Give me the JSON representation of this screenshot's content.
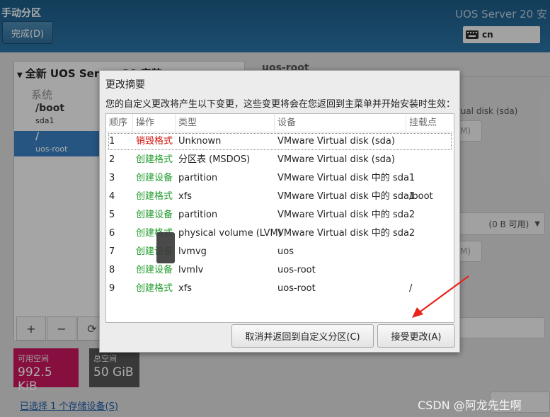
{
  "header": {
    "title": "手动分区",
    "done_label": "完成(D)",
    "product": "UOS Server 20 安",
    "keyboard_layout": "cn"
  },
  "left_panel": {
    "install_title": "全新 UOS Server 20 安装",
    "system_label": "系统",
    "mounts": [
      {
        "mount_point": "/boot",
        "device": "sda1",
        "selected": false
      },
      {
        "mount_point": "/",
        "device": "uos-root",
        "selected": true
      }
    ],
    "tools": {
      "add": "+",
      "remove": "−",
      "refresh": "⟳"
    }
  },
  "space": {
    "available_label": "可用空间",
    "available_value": "992.5 KiB",
    "total_label": "总空间",
    "total_value": "50 GiB"
  },
  "storage_link": "已选择 1 个存储设备(S)",
  "right_panel": {
    "heading": "uos-root",
    "devices_text": "tual disk (sda)",
    "field1_text": "M)",
    "combo_text": "(0 B 可用)",
    "field2_text": "M)"
  },
  "dialog": {
    "title": "更改摘要",
    "description": "您的自定义更改将产生以下变更，这些变更将会在您返回到主菜单并开始安装时生效：",
    "columns": [
      "顺序",
      "操作",
      "类型",
      "设备",
      "挂载点"
    ],
    "rows": [
      {
        "order": "1",
        "action": "销毁格式",
        "action_kind": "destroy",
        "type": "Unknown",
        "device": "VMware Virtual disk (sda)",
        "mount": ""
      },
      {
        "order": "2",
        "action": "创建格式",
        "action_kind": "create",
        "type": "分区表 (MSDOS)",
        "device": "VMware Virtual disk (sda)",
        "mount": ""
      },
      {
        "order": "3",
        "action": "创建设备",
        "action_kind": "create",
        "type": "partition",
        "device": "VMware Virtual disk 中的 sda1",
        "mount": ""
      },
      {
        "order": "4",
        "action": "创建格式",
        "action_kind": "create",
        "type": "xfs",
        "device": "VMware Virtual disk 中的 sda1",
        "mount": "/boot"
      },
      {
        "order": "5",
        "action": "创建设备",
        "action_kind": "create",
        "type": "partition",
        "device": "VMware Virtual disk 中的 sda2",
        "mount": ""
      },
      {
        "order": "6",
        "action": "创建格式",
        "action_kind": "create",
        "type": "physical volume (LVM)",
        "device": "VMware Virtual disk 中的 sda2",
        "mount": ""
      },
      {
        "order": "7",
        "action": "创建设备",
        "action_kind": "create",
        "type": "lvmvg",
        "device": "uos",
        "mount": ""
      },
      {
        "order": "8",
        "action": "创建设备",
        "action_kind": "create",
        "type": "lvmlv",
        "device": "uos-root",
        "mount": ""
      },
      {
        "order": "9",
        "action": "创建格式",
        "action_kind": "create",
        "type": "xfs",
        "device": "uos-root",
        "mount": "/"
      }
    ],
    "cancel_label": "取消并返回到自定义分区(C)",
    "accept_label": "接受更改(A)"
  },
  "watermark": "CSDN @阿龙先生啊",
  "colors": {
    "header_bg": "#2a74a5",
    "destroy": "#d0140e",
    "create": "#1f9b2a",
    "selected": "#3a7fc2",
    "available_space": "#c9175f",
    "annotation_arrow": "#e8231b"
  }
}
